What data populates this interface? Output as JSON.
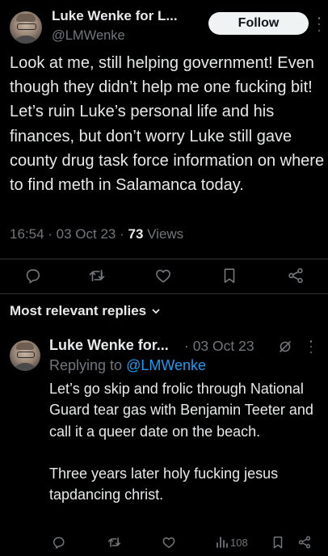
{
  "post": {
    "display_name": "Luke Wenke for L...",
    "handle": "@LMWenke",
    "follow_label": "Follow",
    "text": "Look at me, still helping government! Even though they didn’t help me one fucking bit!  Let’s ruin Luke’s personal life and his finances, but don’t worry Luke still gave county drug task force information on where to find meth in Salamanca today.",
    "time": "16:54",
    "sep1": " · ",
    "date": "03 Oct 23",
    "sep2": " · ",
    "views_count": "73",
    "views_label": " Views"
  },
  "post_actions": {
    "reply_icon": "reply-icon",
    "repost_icon": "repost-icon",
    "like_icon": "like-icon",
    "bookmark_icon": "bookmark-icon",
    "share_icon": "share-icon"
  },
  "replies_header": {
    "label": "Most relevant replies",
    "icon": "chevron-down-icon"
  },
  "reply": {
    "display_name": "Luke Wenke for...",
    "date": " · 03 Oct 23",
    "replying_to_label": "Replying to ",
    "replying_to_handle": "@LMWenke",
    "text": "Let’s go skip and frolic through National Guard tear gas with Benjamin Teeter and call it a queer date on the beach.\n\nThree years later holy fucking jesus tapdancing christ.",
    "views_count": "108"
  },
  "colors": {
    "background": "#000000",
    "text": "#e7e9ea",
    "secondary": "#71767b",
    "link": "#1d9bf0",
    "divider": "#2f3336"
  }
}
